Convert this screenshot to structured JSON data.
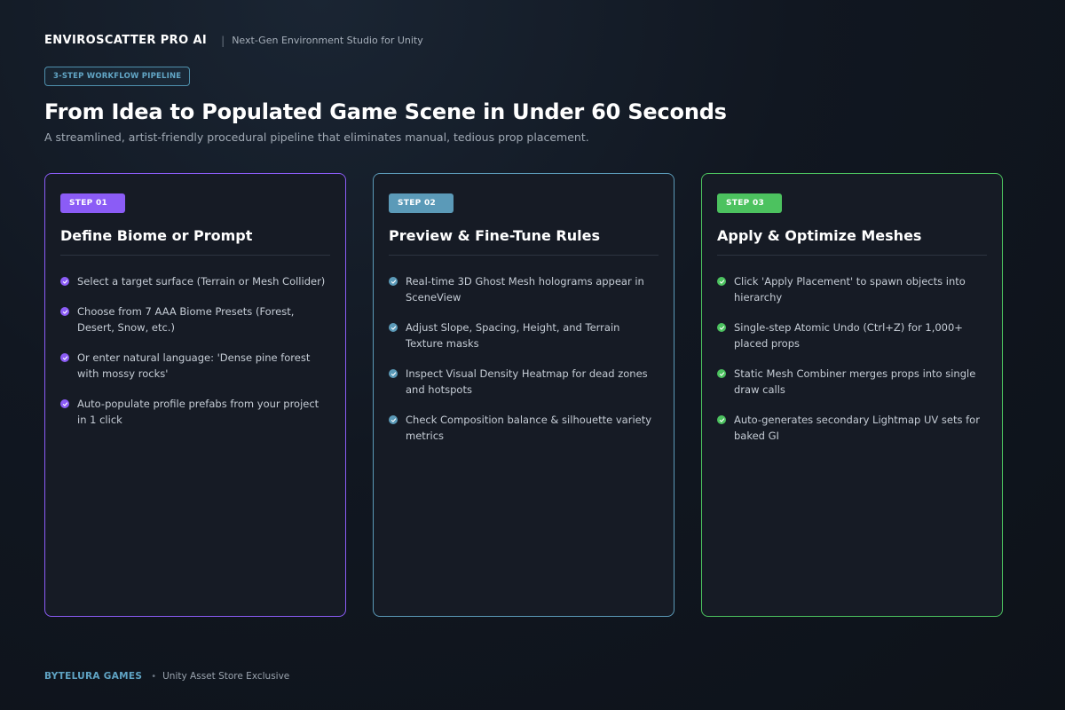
{
  "header": {
    "brand": "ENVIROSCATTER PRO AI",
    "separator": "|",
    "tagline": "Next-Gen Environment Studio for Unity"
  },
  "pill_label": "3-STEP WORKFLOW PIPELINE",
  "title": "From Idea to Populated Game Scene in Under 60 Seconds",
  "subtitle": "A streamlined, artist-friendly procedural pipeline that eliminates manual, tedious prop placement.",
  "steps": [
    {
      "badge": "STEP 01",
      "title": "Define Biome or Prompt",
      "accent": "#8b5cf6",
      "items": [
        "Select a target surface (Terrain or Mesh Collider)",
        "Choose from 7 AAA Biome Presets (Forest, Desert, Snow, etc.)",
        "Or enter natural language: 'Dense pine forest with mossy rocks'",
        "Auto-populate profile prefabs from your project in 1 click"
      ]
    },
    {
      "badge": "STEP 02",
      "title": "Preview & Fine-Tune Rules",
      "accent": "#5b9ab8",
      "items": [
        "Real-time 3D Ghost Mesh holograms appear in SceneView",
        "Adjust Slope, Spacing, Height, and Terrain Texture masks",
        "Inspect Visual Density Heatmap for dead zones and hotspots",
        "Check Composition balance & silhouette variety metrics"
      ]
    },
    {
      "badge": "STEP 03",
      "title": "Apply & Optimize Meshes",
      "accent": "#4cc25f",
      "items": [
        "Click 'Apply Placement' to spawn objects into hierarchy",
        "Single-step Atomic Undo (Ctrl+Z) for 1,000+ placed props",
        "Static Mesh Combiner merges props into single draw calls",
        "Auto-generates secondary Lightmap UV sets for baked GI"
      ]
    }
  ],
  "footer": {
    "brand": "BYTELURA GAMES",
    "dot": "•",
    "note": "Unity Asset Store Exclusive"
  },
  "icons": {
    "item_marker": "check-circle-icon"
  }
}
